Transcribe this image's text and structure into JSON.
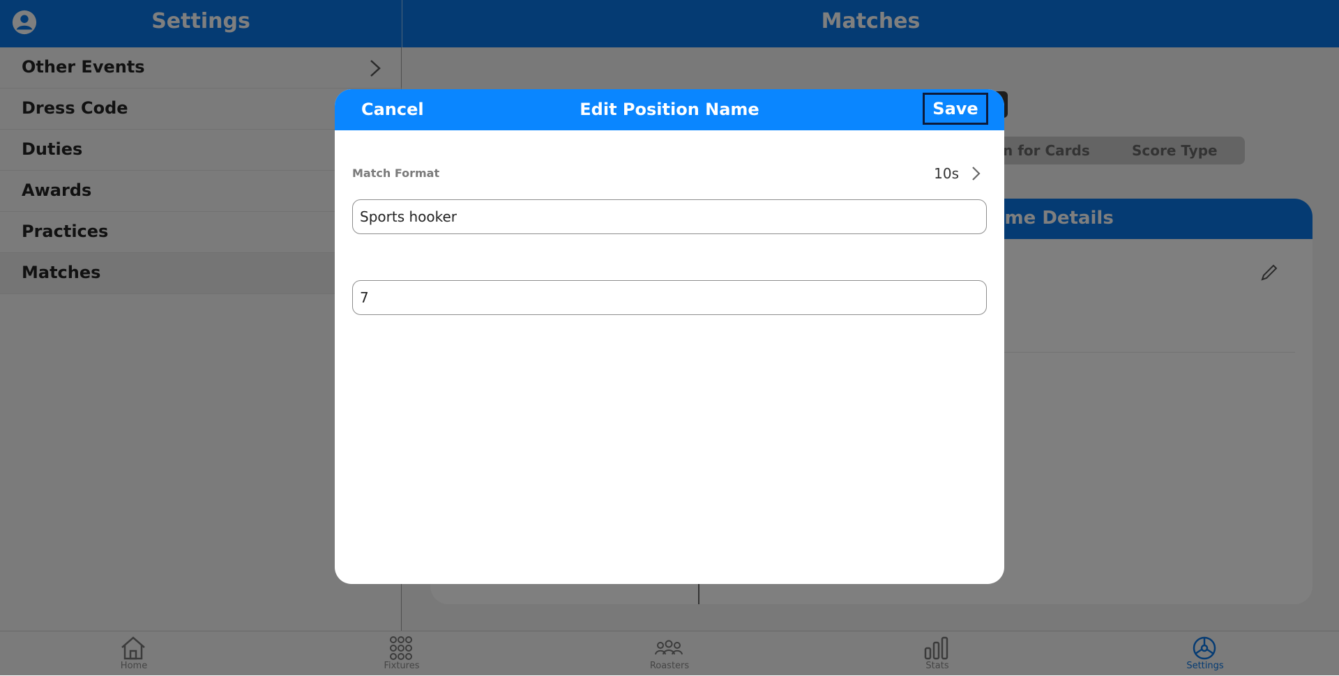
{
  "header": {
    "left_title": "Settings",
    "right_title": "Matches"
  },
  "sidebar": {
    "items": [
      {
        "label": "Other Events"
      },
      {
        "label": "Dress Code"
      },
      {
        "label": "Duties"
      },
      {
        "label": "Awards"
      },
      {
        "label": "Practices"
      },
      {
        "label": "Matches"
      }
    ]
  },
  "main": {
    "segments": [
      "n for Cards",
      "Score Type"
    ],
    "card_title": "ame Details"
  },
  "modal": {
    "title": "Edit Position Name",
    "cancel_label": "Cancel",
    "save_label": "Save",
    "match_format_label": "Match Format",
    "match_format_value": "10s",
    "name_value": "Sports hooker",
    "number_value": "7"
  },
  "tabbar": {
    "tabs": [
      {
        "label": "Home",
        "icon": "home-icon"
      },
      {
        "label": "Fixtures",
        "icon": "grid-dots-icon"
      },
      {
        "label": "Roasters",
        "icon": "people-icon"
      },
      {
        "label": "Stats",
        "icon": "bar-chart-icon"
      },
      {
        "label": "Settings",
        "icon": "settings-icon",
        "active": true
      }
    ]
  },
  "colors": {
    "primary": "#0a77e6",
    "modal_header": "#0a86ff",
    "save_border": "#0c1a3a"
  }
}
